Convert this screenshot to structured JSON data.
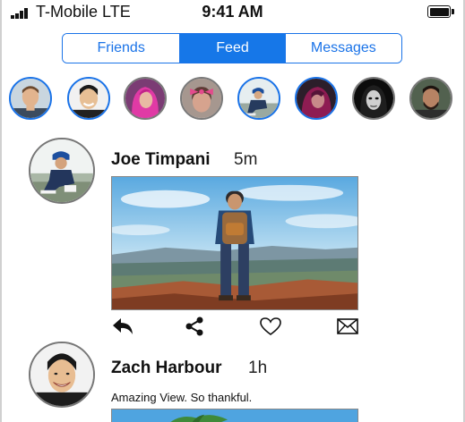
{
  "status_bar": {
    "carrier": "T-Mobile LTE",
    "time": "9:41 AM",
    "signal_icon": "cellular-signal-icon",
    "battery_icon": "battery-full-icon"
  },
  "tabs": [
    {
      "label": "Friends",
      "active": false
    },
    {
      "label": "Feed",
      "active": true
    },
    {
      "label": "Messages",
      "active": false
    }
  ],
  "stories": [
    {
      "avatar": "man-short-hair-photo",
      "ring": "blue"
    },
    {
      "avatar": "smiling-man-photo",
      "ring": "blue"
    },
    {
      "avatar": "woman-pink-hair-photo",
      "ring": "gray"
    },
    {
      "avatar": "girl-pink-bow-photo",
      "ring": "gray"
    },
    {
      "avatar": "man-sitting-cap-photo",
      "ring": "blue"
    },
    {
      "avatar": "woman-dark-magenta-photo",
      "ring": "blue"
    },
    {
      "avatar": "woman-black-white-photo",
      "ring": "gray"
    },
    {
      "avatar": "man-beard-photo",
      "ring": "gray"
    }
  ],
  "posts": [
    {
      "author": "Joe Timpani",
      "time": "5m",
      "image": "hiker-on-mountain-photo",
      "actions": [
        "reply-icon",
        "share-icon",
        "heart-icon",
        "mail-icon"
      ]
    },
    {
      "author": "Zach Harbour",
      "time": "1h",
      "caption": "Amazing View. So thankful.",
      "image": "palm-tree-sky-photo"
    }
  ],
  "colors": {
    "accent": "#1677e8",
    "story_ring_seen": "#7a7a7a"
  }
}
